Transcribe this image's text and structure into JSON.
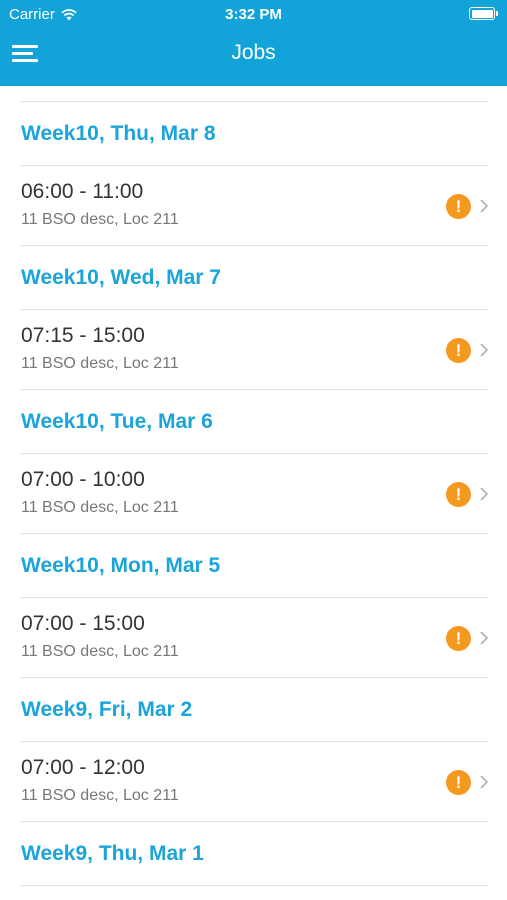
{
  "status": {
    "carrier": "Carrier",
    "time": "3:32 PM"
  },
  "nav": {
    "title": "Jobs"
  },
  "groups": [
    {
      "header": "Week10, Thu, Mar 8",
      "job": {
        "time": "06:00 - 11:00",
        "desc": "11 BSO desc, Loc 211",
        "alert": "!"
      }
    },
    {
      "header": "Week10, Wed, Mar 7",
      "job": {
        "time": "07:15 - 15:00",
        "desc": "11 BSO desc, Loc 211",
        "alert": "!"
      }
    },
    {
      "header": "Week10, Tue, Mar 6",
      "job": {
        "time": "07:00 - 10:00",
        "desc": "11 BSO desc, Loc 211",
        "alert": "!"
      }
    },
    {
      "header": "Week10, Mon, Mar 5",
      "job": {
        "time": "07:00 - 15:00",
        "desc": "11 BSO desc, Loc 211",
        "alert": "!"
      }
    },
    {
      "header": "Week9, Fri, Mar 2",
      "job": {
        "time": "07:00 - 12:00",
        "desc": "11 BSO desc, Loc 211",
        "alert": "!"
      }
    },
    {
      "header": "Week9, Thu, Mar 1"
    }
  ],
  "colors": {
    "header_bg": "#12a3d8",
    "section_text": "#1ba4d9",
    "alert": "#f39a1e"
  }
}
